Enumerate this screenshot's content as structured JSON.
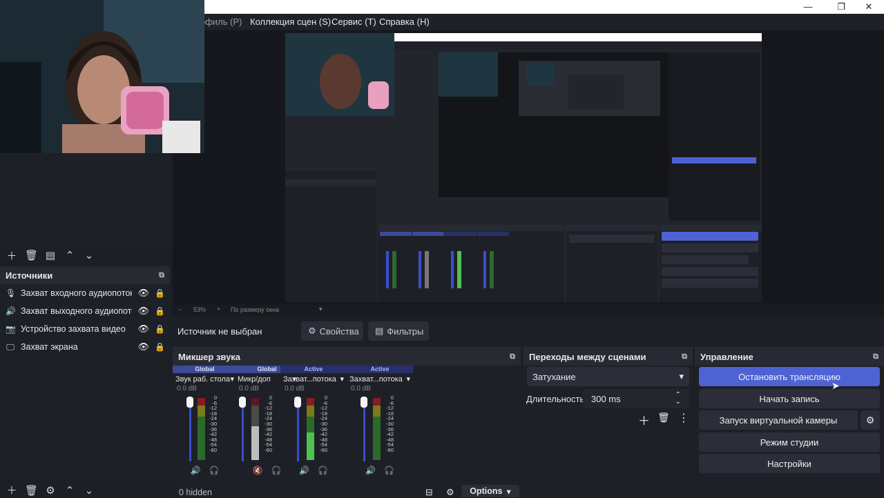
{
  "window": {
    "minimize_glyph": "—",
    "maximize_glyph": "❐",
    "close_glyph": "✕"
  },
  "menu": {
    "profile": "офиль (P)",
    "scene_collection": "Коллекция сцен (S)",
    "tools": "Сервис (T)",
    "help": "Справка (H)"
  },
  "sources": {
    "title": "Источники",
    "items": [
      {
        "icon": "microphone-icon",
        "label": "Захват входного аудиопотока"
      },
      {
        "icon": "speaker-icon",
        "label": "Захват выходного аудиопотока"
      },
      {
        "icon": "camera-icon",
        "label": "Устройство захвата видео"
      },
      {
        "icon": "monitor-icon",
        "label": "Захват экрана"
      }
    ]
  },
  "zoom": {
    "level": "53%",
    "mode": "По размеру окна"
  },
  "source_bar": {
    "no_source": "Источник не выбран",
    "properties": "Свойства",
    "filters": "Фильтры"
  },
  "mixer": {
    "title": "Микшер звука",
    "hidden_label": "0 hidden",
    "options_label": "Options",
    "channels": [
      {
        "tag": "Global",
        "name": "Звук раб. стола",
        "db": "0.0 dB",
        "level": 0.0,
        "muted": false
      },
      {
        "tag": "Global",
        "name": "Микр/доп",
        "db": "0.0 dB",
        "level": 0.55,
        "muted": true
      },
      {
        "tag": "Active",
        "name": "Захват...потока",
        "db": "0.0 dB",
        "level": 0.45,
        "muted": false
      },
      {
        "tag": "Active",
        "name": "Захват...потока",
        "db": "0.0 dB",
        "level": 0.0,
        "muted": false
      }
    ],
    "scale": [
      "0",
      "-6",
      "-12",
      "-18",
      "-24",
      "-30",
      "-36",
      "-42",
      "-48",
      "-54",
      "-60"
    ]
  },
  "transitions": {
    "title": "Переходы между сценами",
    "selected": "Затухание",
    "duration_label": "Длительность",
    "duration_value": "300 ms"
  },
  "controls": {
    "title": "Управление",
    "stop_stream": "Остановить трансляцию",
    "start_record": "Начать запись",
    "virtual_cam": "Запуск виртуальной камеры",
    "studio_mode": "Режим студии",
    "settings": "Настройки"
  },
  "colors": {
    "accent": "#4e62d4",
    "panel": "#1e2027",
    "header": "#272a33"
  }
}
